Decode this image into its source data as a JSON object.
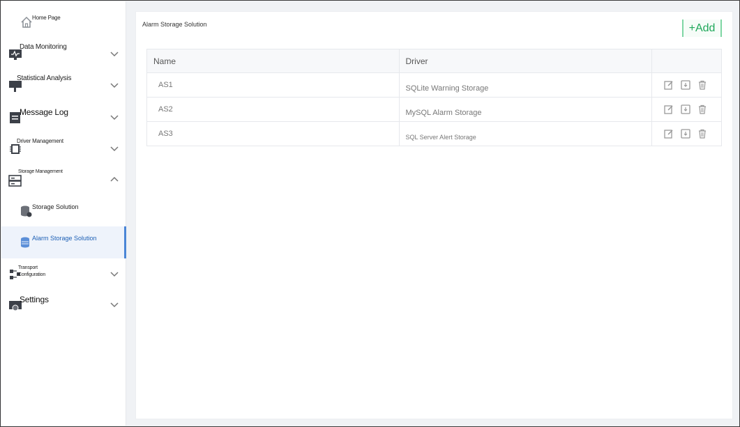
{
  "page": {
    "title": "Alarm Storage Solution",
    "add_label": "+Add"
  },
  "colors": {
    "accent_green": "#1fa85a",
    "active_blue": "#1c5fb5"
  },
  "sidebar": {
    "home": {
      "label": "Home Page",
      "icon": "home-icon"
    },
    "items": [
      {
        "label": "Data Monitoring",
        "icon": "monitor-icon",
        "expanded": false
      },
      {
        "label": "Statistical Analysis",
        "icon": "analysis-icon",
        "expanded": false
      },
      {
        "label": "Message Log",
        "icon": "log-icon",
        "expanded": false
      },
      {
        "label": "Driver Management",
        "icon": "chip-icon",
        "expanded": false
      },
      {
        "label": "Storage Management",
        "icon": "server-icon",
        "expanded": true
      },
      {
        "label": "Transport Configuration",
        "icon": "transport-icon",
        "expanded": false
      },
      {
        "label": "Settings",
        "icon": "settings-icon",
        "expanded": false
      }
    ],
    "subitems": [
      {
        "label": "Storage Solution",
        "icon": "database-icon",
        "active": false
      },
      {
        "label": "Alarm Storage Solution",
        "icon": "database-icon",
        "active": true
      }
    ]
  },
  "table": {
    "columns": [
      "Name",
      "Driver",
      ""
    ],
    "rows": [
      {
        "name": "AS1",
        "driver": "SQLite Warning Storage"
      },
      {
        "name": "AS2",
        "driver": "MySQL Alarm Storage"
      },
      {
        "name": "AS3",
        "driver": "SQL Server Alert Storage"
      }
    ],
    "actions": [
      "edit-icon",
      "export-icon",
      "delete-icon"
    ]
  }
}
